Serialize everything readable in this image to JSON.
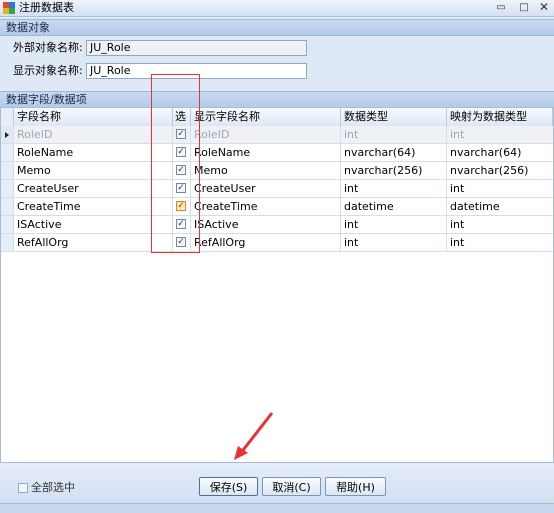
{
  "window": {
    "title": "注册数据表",
    "min": "▭",
    "max": "□",
    "close": "✕"
  },
  "section_object": {
    "header": "数据对象",
    "external_label": "外部对象名称:",
    "external_value": "JU_Role",
    "display_label": "显示对象名称:",
    "display_value": "JU_Role"
  },
  "section_fields": {
    "header": "数据字段/数据项"
  },
  "grid": {
    "columns": [
      "字段名称",
      "选",
      "显示字段名称",
      "数据类型",
      "映射为数据类型"
    ],
    "rows": [
      {
        "field": "RoleID",
        "checked": "✓",
        "display": "RoleID",
        "type": "int",
        "mapped": "int"
      },
      {
        "field": "RoleName",
        "checked": "✓",
        "display": "RoleName",
        "type": "nvarchar(64)",
        "mapped": "nvarchar(64)"
      },
      {
        "field": "Memo",
        "checked": "✓",
        "display": "Memo",
        "type": "nvarchar(256)",
        "mapped": "nvarchar(256)"
      },
      {
        "field": "CreateUser",
        "checked": "✓",
        "display": "CreateUser",
        "type": "int",
        "mapped": "int"
      },
      {
        "field": "CreateTime",
        "checked": "✓",
        "display": "CreateTime",
        "type": "datetime",
        "mapped": "datetime"
      },
      {
        "field": "ISActive",
        "checked": "✓",
        "display": "ISActive",
        "type": "int",
        "mapped": "int"
      },
      {
        "field": "RefAllOrg",
        "checked": "✓",
        "display": "RefAllOrg",
        "type": "int",
        "mapped": "int"
      }
    ]
  },
  "footer": {
    "select_all": "全部选中",
    "save": "保存(S)",
    "cancel": "取消(C)",
    "help": "帮助(H)"
  },
  "colors": {
    "annotation": "#e53232",
    "header_bg": "#c8daf0",
    "window_bg": "#dfe9f6"
  },
  "icons": [
    "app-icon",
    "minimize-icon",
    "maximize-icon",
    "close-icon",
    "row-pointer-icon",
    "checkbox-icon"
  ]
}
